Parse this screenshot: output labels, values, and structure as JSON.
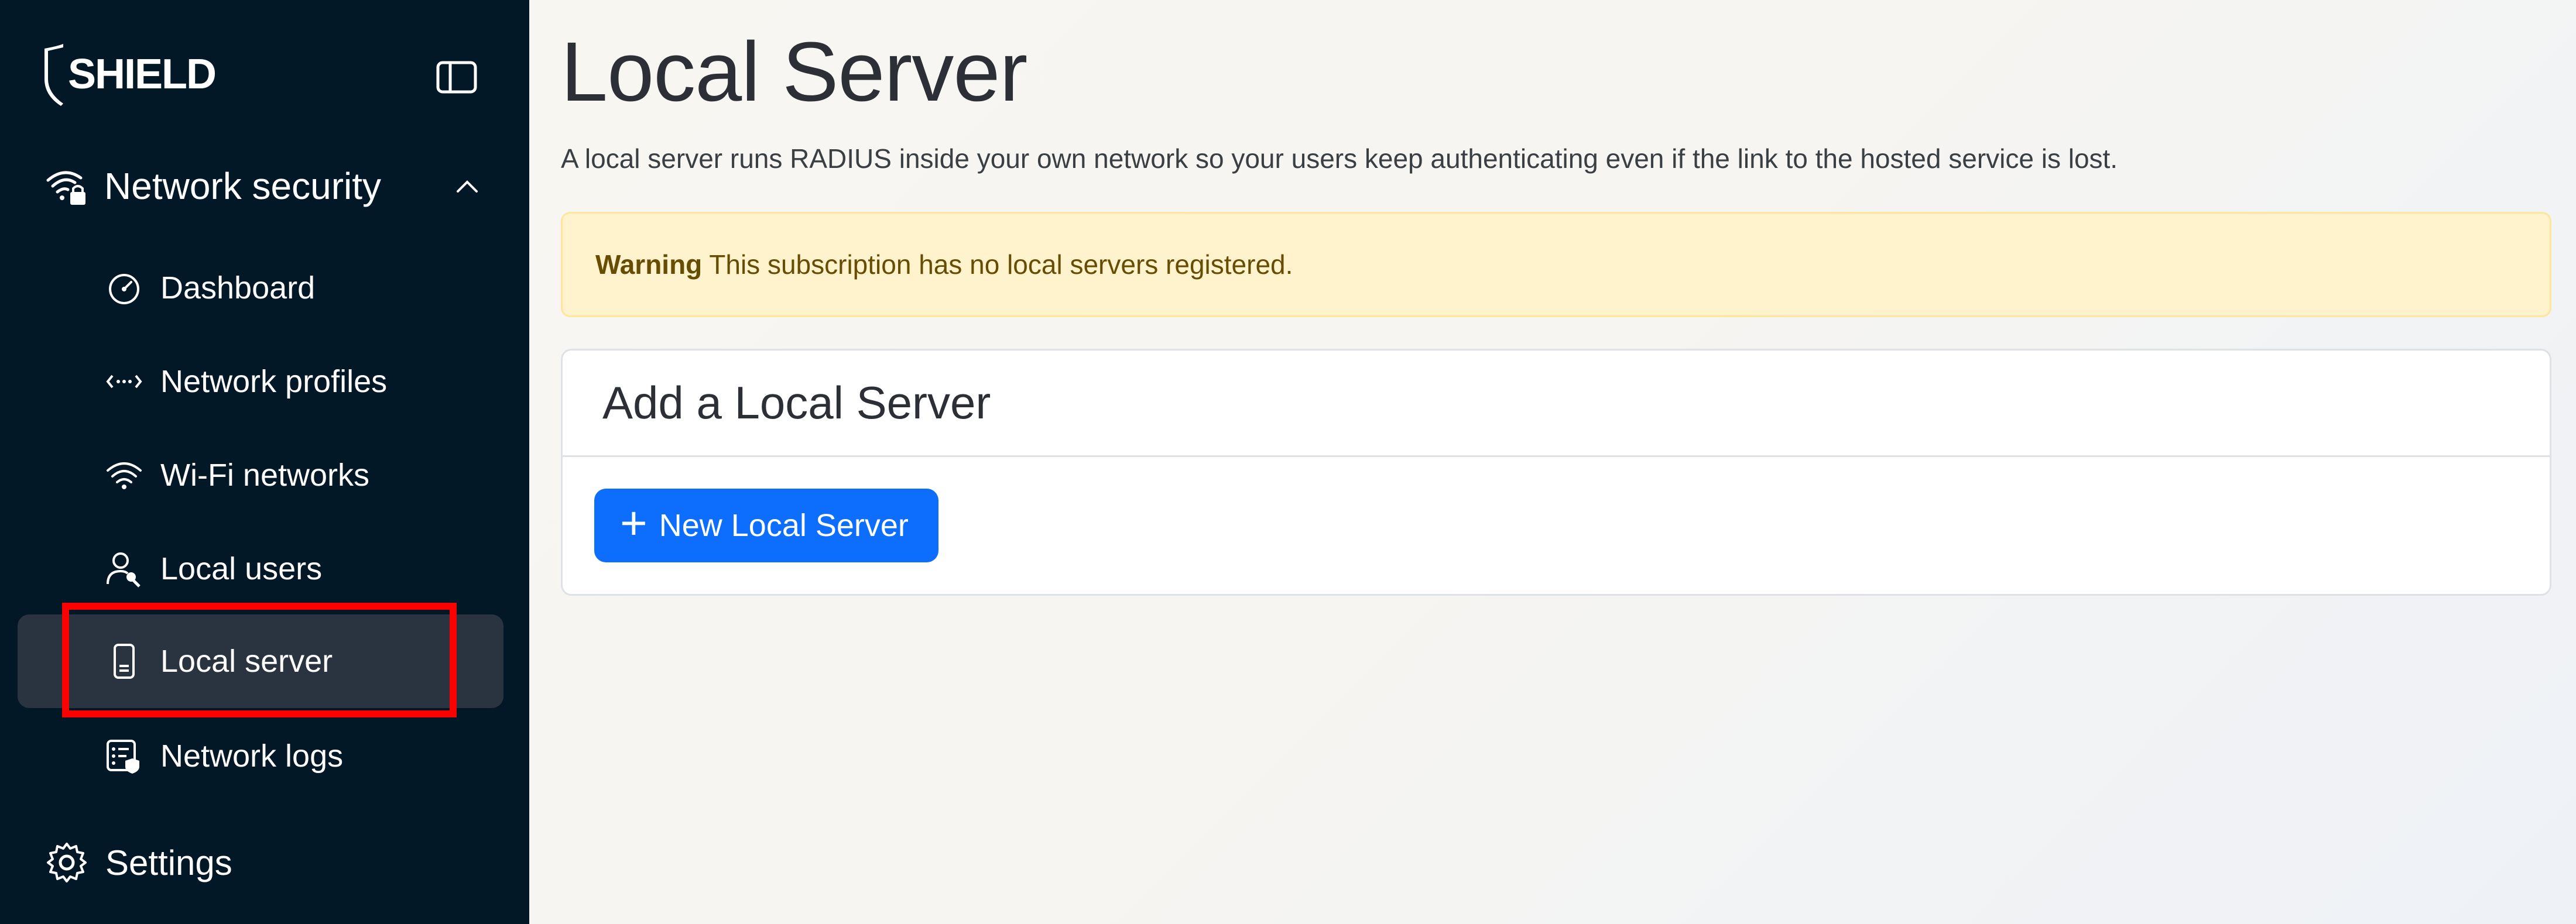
{
  "brand": {
    "name": "SHIELD"
  },
  "sidebar": {
    "group": {
      "label": "Network security",
      "icon": "wifi-lock-icon",
      "expanded": true
    },
    "items": [
      {
        "label": "Dashboard",
        "icon": "speedometer-icon"
      },
      {
        "label": "Network profiles",
        "icon": "dots-arrows-icon"
      },
      {
        "label": "Wi-Fi networks",
        "icon": "wifi-icon"
      },
      {
        "label": "Local users",
        "icon": "user-key-icon"
      },
      {
        "label": "Local server",
        "icon": "server-phone-icon",
        "active": true
      },
      {
        "label": "Network logs",
        "icon": "log-list-icon"
      }
    ],
    "settings": {
      "label": "Settings",
      "icon": "gear-icon"
    }
  },
  "main": {
    "title": "Local Server",
    "description": "A local server runs RADIUS inside your own network so your users keep authenticating even if the link to the hosted service is lost.",
    "alert": {
      "strong": "Warning",
      "text": "This subscription has no local servers registered."
    },
    "card": {
      "title": "Add a Local Server",
      "button_label": "New Local Server"
    }
  },
  "colors": {
    "sidebar_bg": "#031827",
    "active_item_bg": "#2a3340",
    "highlight": "#ff0000",
    "primary": "#0d6efd",
    "alert_bg": "#fff3cd",
    "alert_text": "#664d03"
  }
}
